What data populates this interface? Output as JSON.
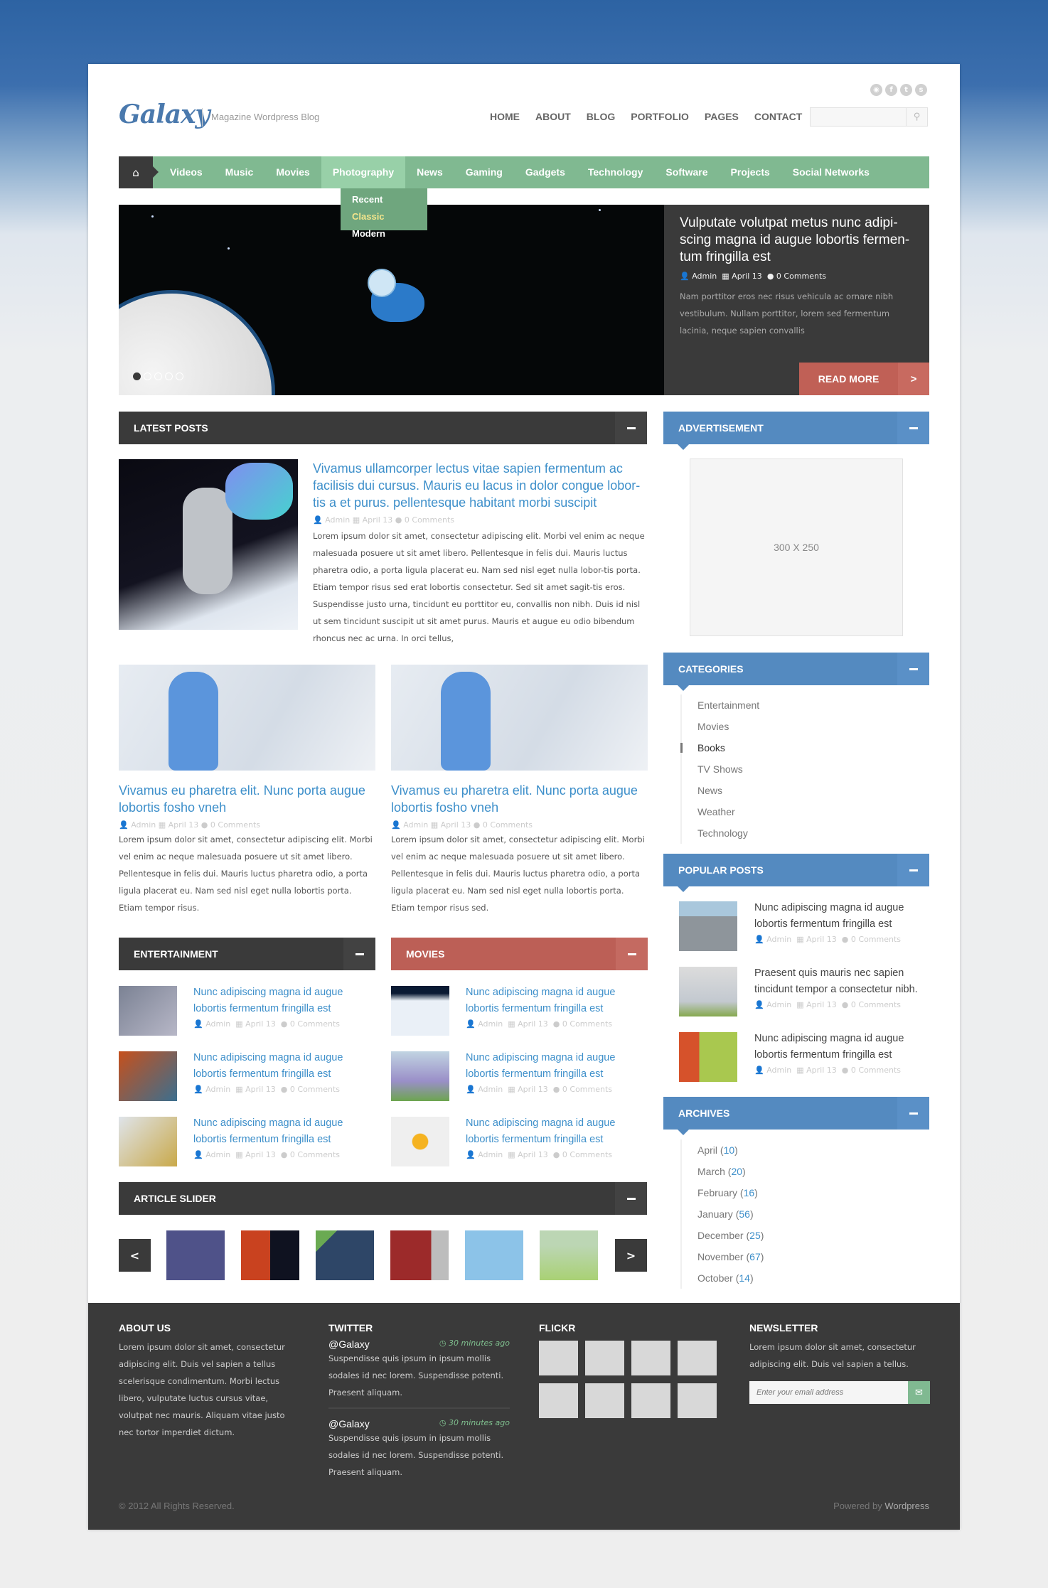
{
  "header": {
    "logo": "Galaxy",
    "tagline": "Magazine Wordpress Blog",
    "social_icons": [
      "rss-icon",
      "facebook-icon",
      "twitter-icon",
      "skype-icon"
    ],
    "top_nav": [
      "HOME",
      "ABOUT",
      "BLOG",
      "PORTFOLIO",
      "PAGES",
      "CONTACT"
    ],
    "search": {
      "placeholder": "",
      "value": ""
    }
  },
  "category_nav": {
    "items": [
      "Videos",
      "Music",
      "Movies",
      "Photography",
      "News",
      "Gaming",
      "Gadgets",
      "Technology",
      "Software",
      "Projects",
      "Social Networks"
    ],
    "active": "Photography",
    "dropdown": [
      "Recent",
      "Classic",
      "Modern"
    ],
    "dropdown_highlighted": "Classic"
  },
  "slider": {
    "title": "Vulputate volutpat metus nunc adipi-scing magna id augue lobortis fermen-tum fringilla est",
    "author": "Admin",
    "date": "April 13",
    "comments": "0 Comments",
    "excerpt": "Nam porttitor eros nec risus vehicula ac ornare nibh vestibulum. Nullam porttitor, lorem sed fermentum lacinia, neque sapien convallis",
    "read_more": "READ MORE",
    "arrow": ">",
    "slide_count": 5,
    "current_slide": 1
  },
  "latest_posts": {
    "heading": "LATEST POSTS",
    "featured": {
      "title": "Vivamus ullamcorper lectus vitae sapien fermentum ac facilisis dui cursus. Mauris eu lacus in dolor congue lobor-tis a et purus. pellentesque habitant morbi suscipit",
      "author": "Admin",
      "date": "April 13",
      "comments": "0 Comments",
      "body": "Lorem ipsum dolor sit amet, consectetur adipiscing elit. Morbi vel enim ac neque malesuada posuere ut sit amet libero. Pellentesque in felis dui. Mauris luctus pharetra odio, a porta ligula placerat eu. Nam sed nisl eget nulla lobor-tis porta. Etiam tempor risus sed erat lobortis consectetur. Sed sit amet sagit-tis eros. Suspendisse justo urna, tincidunt eu porttitor eu, convallis non nibh. Duis id nisl ut sem tincidunt suscipit ut sit amet purus. Mauris et augue eu odio bibendum rhoncus nec ac urna. In orci tellus,"
    },
    "grid": [
      {
        "title": "Vivamus eu pharetra elit. Nunc porta augue lobortis fosho vneh",
        "author": "Admin",
        "date": "April 13",
        "comments": "0 Comments",
        "body": "Lorem ipsum dolor sit amet, consectetur adipiscing elit. Morbi vel enim ac neque malesuada posuere ut sit amet libero. Pellentesque in felis dui. Mauris luctus pharetra odio, a porta ligula placerat eu. Nam sed nisl eget nulla lobortis porta. Etiam tempor risus."
      },
      {
        "title": "Vivamus eu pharetra elit. Nunc porta augue lobortis fosho vneh",
        "author": "Admin",
        "date": "April 13",
        "comments": "0 Comments",
        "body": "Lorem ipsum dolor sit amet, consectetur adipiscing elit. Morbi vel enim ac neque malesuada posuere ut sit amet libero. Pellentesque in felis dui. Mauris luctus pharetra odio, a porta ligula placerat eu. Nam sed nisl eget nulla lobortis porta. Etiam tempor risus sed."
      }
    ]
  },
  "entertainment": {
    "heading": "ENTERTAINMENT",
    "items": [
      {
        "title": "Nunc adipiscing magna id augue lobortis fermentum fringilla est",
        "author": "Admin",
        "date": "April 13",
        "comments": "0 Comments"
      },
      {
        "title": "Nunc adipiscing magna id augue lobortis fermentum fringilla est",
        "author": "Admin",
        "date": "April 13",
        "comments": "0 Comments"
      },
      {
        "title": "Nunc adipiscing magna id augue lobortis fermentum fringilla est",
        "author": "Admin",
        "date": "April 13",
        "comments": "0 Comments"
      }
    ]
  },
  "movies": {
    "heading": "MOVIES",
    "items": [
      {
        "title": "Nunc adipiscing magna id augue lobortis fermentum fringilla est",
        "author": "Admin",
        "date": "April 13",
        "comments": "0 Comments"
      },
      {
        "title": "Nunc adipiscing magna id augue lobortis fermentum fringilla est",
        "author": "Admin",
        "date": "April 13",
        "comments": "0 Comments"
      },
      {
        "title": "Nunc adipiscing magna id augue lobortis fermentum fringilla est",
        "author": "Admin",
        "date": "April 13",
        "comments": "0 Comments"
      }
    ]
  },
  "article_slider": {
    "heading": "ARTICLE SLIDER",
    "prev": "<",
    "next": ">",
    "thumb_count": 6
  },
  "sidebar": {
    "advertisement": {
      "heading": "ADVERTISEMENT",
      "placeholder": "300 X 250"
    },
    "categories": {
      "heading": "CATEGORIES",
      "items": [
        "Entertainment",
        "Movies",
        "Books",
        "TV Shows",
        "News",
        "Weather",
        "Technology"
      ],
      "selected": "Books"
    },
    "popular_posts": {
      "heading": "POPULAR POSTS",
      "items": [
        {
          "title": "Nunc adipiscing magna id augue lobortis fermentum fringilla est",
          "author": "Admin",
          "date": "April 13",
          "comments": "0 Comments"
        },
        {
          "title": "Praesent quis mauris nec sapien tincidunt tempor a consectetur nibh.",
          "author": "Admin",
          "date": "April 13",
          "comments": "0 Comments"
        },
        {
          "title": "Nunc adipiscing magna id augue lobortis fermentum fringilla est",
          "author": "Admin",
          "date": "April 13",
          "comments": "0 Comments"
        }
      ]
    },
    "archives": {
      "heading": "ARCHIVES",
      "items": [
        {
          "month": "April",
          "count": "10"
        },
        {
          "month": "March",
          "count": "20"
        },
        {
          "month": "February",
          "count": "16"
        },
        {
          "month": "January",
          "count": "56"
        },
        {
          "month": "December",
          "count": "25"
        },
        {
          "month": "November",
          "count": "67"
        },
        {
          "month": "October",
          "count": "14"
        }
      ]
    }
  },
  "footer": {
    "about": {
      "heading": "ABOUT US",
      "text": "Lorem ipsum dolor sit amet, consectetur adipiscing elit. Duis vel sapien a tellus scelerisque condimentum. Morbi lectus libero, vulputate luctus cursus vitae, volutpat nec mauris. Aliquam vitae justo nec tortor imperdiet dictum."
    },
    "twitter": {
      "heading": "TWITTER",
      "tweets": [
        {
          "handle": "@Galaxy",
          "time": "30 minutes ago",
          "text": "Suspendisse quis ipsum in ipsum mollis sodales id nec lorem. Suspendisse potenti. Praesent aliquam."
        },
        {
          "handle": "@Galaxy",
          "time": "30 minutes ago",
          "text": "Suspendisse quis ipsum in ipsum mollis sodales id nec lorem. Suspendisse potenti. Praesent aliquam."
        }
      ]
    },
    "flickr": {
      "heading": "FLICKR",
      "photo_count": 8
    },
    "newsletter": {
      "heading": "NEWSLETTER",
      "text": "Lorem ipsum dolor sit amet, consectetur adipiscing elit. Duis vel sapien a tellus.",
      "placeholder": "Enter your email address"
    },
    "copyright": "© 2012 All Rights Reserved.",
    "powered_prefix": "Powered by",
    "powered_link": "Wordpress"
  },
  "colors": {
    "nav_green": "#80b991",
    "dark": "#3a3a3a",
    "red": "#bc5f56",
    "blue": "#548ac0",
    "link": "#3d8fca"
  }
}
